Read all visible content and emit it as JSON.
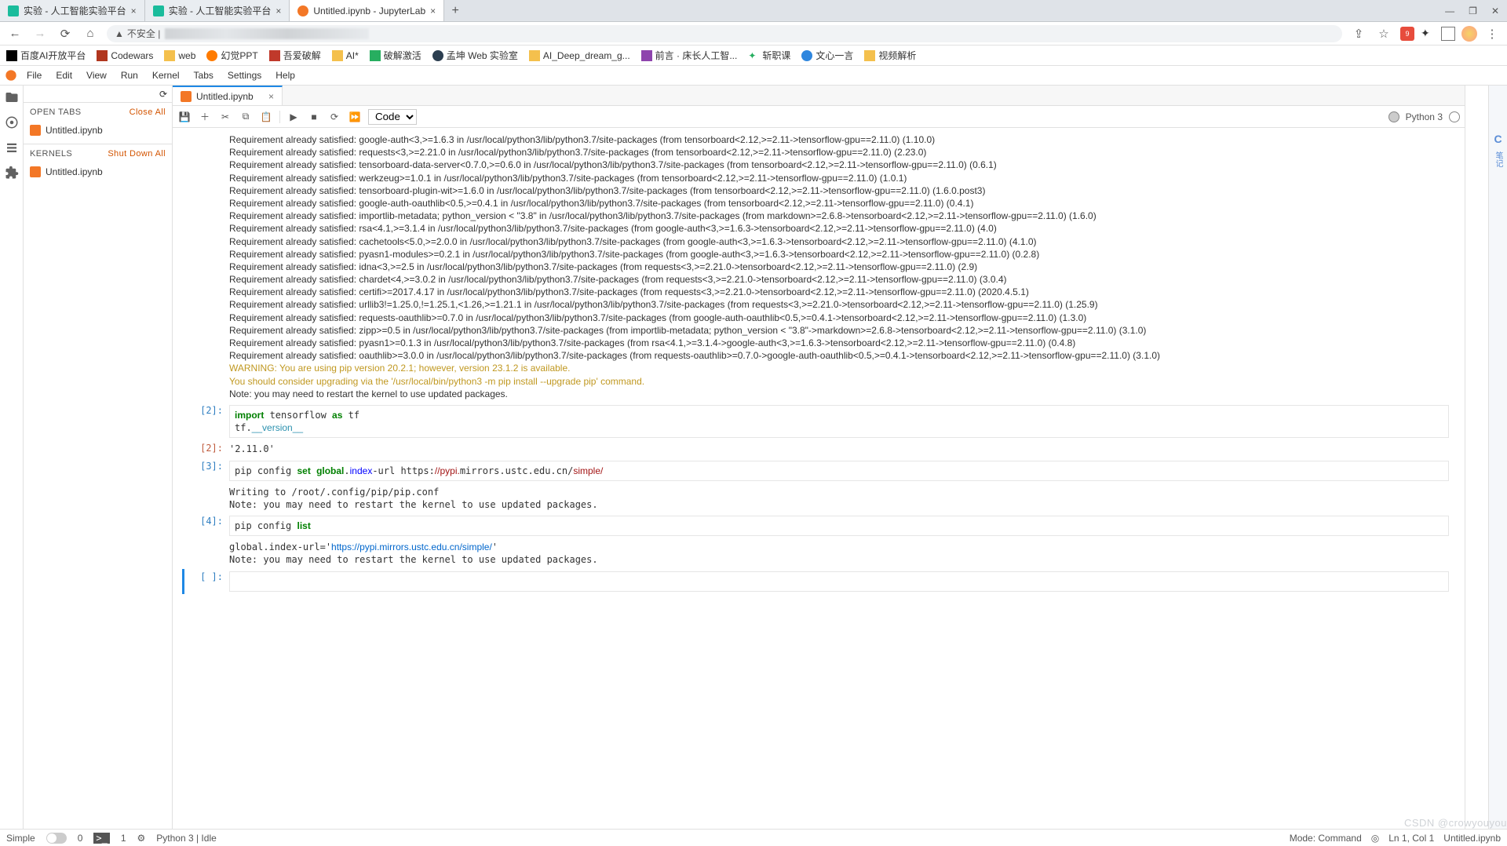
{
  "browserTabs": [
    {
      "label": "实验 - 人工智能实验平台",
      "favColor": "#1abc9c",
      "active": false
    },
    {
      "label": "实验 - 人工智能实验平台",
      "favColor": "#1abc9c",
      "active": false
    },
    {
      "label": "Untitled.ipynb - JupyterLab",
      "favColor": "#f37726",
      "active": true
    }
  ],
  "windowControls": {
    "min": "—",
    "max": "❐",
    "close": "✕"
  },
  "addrbar": {
    "back": "←",
    "fwd": "→",
    "reload": "⟳",
    "home": "⌂",
    "insecure": "不安全 |",
    "star": "☆",
    "share": "⇪"
  },
  "ext": {
    "reddish": "9"
  },
  "bookmarks": [
    {
      "label": "百度AI开放平台",
      "color": "#000"
    },
    {
      "label": "Codewars",
      "color": "#b1361e"
    },
    {
      "label": "web",
      "color": "#f4c04d"
    },
    {
      "label": "幻觉PPT",
      "color": "#ff7b00"
    },
    {
      "label": "吾爱破解",
      "color": "#c0392b"
    },
    {
      "label": "AI*",
      "color": "#f4c04d"
    },
    {
      "label": "破解激活",
      "color": "#27ae60"
    },
    {
      "label": "孟坤 Web 实验室",
      "color": "#2c3e50"
    },
    {
      "label": "AI_Deep_dream_g...",
      "color": "#f4c04d"
    },
    {
      "label": "前言 · 床长人工智...",
      "color": "#8e44ad"
    },
    {
      "label": "斩职课",
      "color": "#27ae60"
    },
    {
      "label": "文心一言",
      "color": "#2e86de"
    },
    {
      "label": "视频解析",
      "color": "#f4c04d"
    }
  ],
  "jlmenu": [
    "File",
    "Edit",
    "View",
    "Run",
    "Kernel",
    "Tabs",
    "Settings",
    "Help"
  ],
  "leftpanel": {
    "openTabs": "OPEN TABS",
    "closeAll": "Close All",
    "tabFile": "Untitled.ipynb",
    "kernels": "KERNELS",
    "shutdownAll": "Shut Down All",
    "kernelFile": "Untitled.ipynb"
  },
  "docTab": {
    "name": "Untitled.ipynb"
  },
  "toolbar": {
    "celltype": "Code",
    "kernel": "Python 3"
  },
  "pipOutput": [
    "Requirement already satisfied: google-auth<3,>=1.6.3 in /usr/local/python3/lib/python3.7/site-packages (from tensorboard<2.12,>=2.11->tensorflow-gpu==2.11.0) (1.10.0)",
    "Requirement already satisfied: requests<3,>=2.21.0 in /usr/local/python3/lib/python3.7/site-packages (from tensorboard<2.12,>=2.11->tensorflow-gpu==2.11.0) (2.23.0)",
    "Requirement already satisfied: tensorboard-data-server<0.7.0,>=0.6.0 in /usr/local/python3/lib/python3.7/site-packages (from tensorboard<2.12,>=2.11->tensorflow-gpu==2.11.0) (0.6.1)",
    "Requirement already satisfied: werkzeug>=1.0.1 in /usr/local/python3/lib/python3.7/site-packages (from tensorboard<2.12,>=2.11->tensorflow-gpu==2.11.0) (1.0.1)",
    "Requirement already satisfied: tensorboard-plugin-wit>=1.6.0 in /usr/local/python3/lib/python3.7/site-packages (from tensorboard<2.12,>=2.11->tensorflow-gpu==2.11.0) (1.6.0.post3)",
    "Requirement already satisfied: google-auth-oauthlib<0.5,>=0.4.1 in /usr/local/python3/lib/python3.7/site-packages (from tensorboard<2.12,>=2.11->tensorflow-gpu==2.11.0) (0.4.1)",
    "Requirement already satisfied: importlib-metadata; python_version < \"3.8\" in /usr/local/python3/lib/python3.7/site-packages (from markdown>=2.6.8->tensorboard<2.12,>=2.11->tensorflow-gpu==2.11.0) (1.6.0)",
    "Requirement already satisfied: rsa<4.1,>=3.1.4 in /usr/local/python3/lib/python3.7/site-packages (from google-auth<3,>=1.6.3->tensorboard<2.12,>=2.11->tensorflow-gpu==2.11.0) (4.0)",
    "Requirement already satisfied: cachetools<5.0,>=2.0.0 in /usr/local/python3/lib/python3.7/site-packages (from google-auth<3,>=1.6.3->tensorboard<2.12,>=2.11->tensorflow-gpu==2.11.0) (4.1.0)",
    "Requirement already satisfied: pyasn1-modules>=0.2.1 in /usr/local/python3/lib/python3.7/site-packages (from google-auth<3,>=1.6.3->tensorboard<2.12,>=2.11->tensorflow-gpu==2.11.0) (0.2.8)",
    "Requirement already satisfied: idna<3,>=2.5 in /usr/local/python3/lib/python3.7/site-packages (from requests<3,>=2.21.0->tensorboard<2.12,>=2.11->tensorflow-gpu==2.11.0) (2.9)",
    "Requirement already satisfied: chardet<4,>=3.0.2 in /usr/local/python3/lib/python3.7/site-packages (from requests<3,>=2.21.0->tensorboard<2.12,>=2.11->tensorflow-gpu==2.11.0) (3.0.4)",
    "Requirement already satisfied: certifi>=2017.4.17 in /usr/local/python3/lib/python3.7/site-packages (from requests<3,>=2.21.0->tensorboard<2.12,>=2.11->tensorflow-gpu==2.11.0) (2020.4.5.1)",
    "Requirement already satisfied: urllib3!=1.25.0,!=1.25.1,<1.26,>=1.21.1 in /usr/local/python3/lib/python3.7/site-packages (from requests<3,>=2.21.0->tensorboard<2.12,>=2.11->tensorflow-gpu==2.11.0) (1.25.9)",
    "Requirement already satisfied: requests-oauthlib>=0.7.0 in /usr/local/python3/lib/python3.7/site-packages (from google-auth-oauthlib<0.5,>=0.4.1->tensorboard<2.12,>=2.11->tensorflow-gpu==2.11.0) (1.3.0)",
    "Requirement already satisfied: zipp>=0.5 in /usr/local/python3/lib/python3.7/site-packages (from importlib-metadata; python_version < \"3.8\"->markdown>=2.6.8->tensorboard<2.12,>=2.11->tensorflow-gpu==2.11.0) (3.1.0)",
    "Requirement already satisfied: pyasn1>=0.1.3 in /usr/local/python3/lib/python3.7/site-packages (from rsa<4.1,>=3.1.4->google-auth<3,>=1.6.3->tensorboard<2.12,>=2.11->tensorflow-gpu==2.11.0) (0.4.8)",
    "Requirement already satisfied: oauthlib>=3.0.0 in /usr/local/python3/lib/python3.7/site-packages (from requests-oauthlib>=0.7.0->google-auth-oauthlib<0.5,>=0.4.1->tensorboard<2.12,>=2.11->tensorflow-gpu==2.11.0) (3.1.0)"
  ],
  "pipWarn": "WARNING: You are using pip version 20.2.1; however, version 23.1.2 is available.\nYou should consider upgrading via the '/usr/local/bin/python3 -m pip install --upgrade pip' command.",
  "pipNote": "Note: you may need to restart the kernel to use updated packages.",
  "cell2": {
    "prompt": "[2]:",
    "code_html": "<span class='kw-green'>import</span> tensorflow <span class='kw-green'>as</span> tf\ntf.<span class='kw-cyan'>__version__</span>",
    "out": "'2.11.0'"
  },
  "cell3": {
    "prompt": "[3]:",
    "code_html": "pip config <span class='kw-green'>set</span> <span class='kw-green'>global</span>.<span class='kw-blue'>index</span>-url https:<span class='str-red'>//pypi.</span>mirrors.ustc.edu.cn/<span class='str-red'>simple/</span>",
    "out": "Writing to /root/.config/pip/pip.conf\nNote: you may need to restart the kernel to use updated packages."
  },
  "cell4": {
    "prompt": "[4]:",
    "code_html": "pip config <span class='kw-green'>list</span>",
    "out_html": "global.index-url='<span class='url'>https://pypi.mirrors.ustc.edu.cn/simple/</span>'\nNote: you may need to restart the kernel to use updated packages."
  },
  "cell5": {
    "prompt": "[ ]:"
  },
  "status": {
    "simple": "Simple",
    "zero": "0",
    "one": "1",
    "kernel": "Python 3 | Idle",
    "mode": "Mode: Command",
    "ln": "Ln 1, Col 1",
    "file": "Untitled.ipynb"
  },
  "watermark": {
    "l1": "CSDN @crowyouyou"
  },
  "notes": {
    "c": "C",
    "txt": "笔记"
  }
}
